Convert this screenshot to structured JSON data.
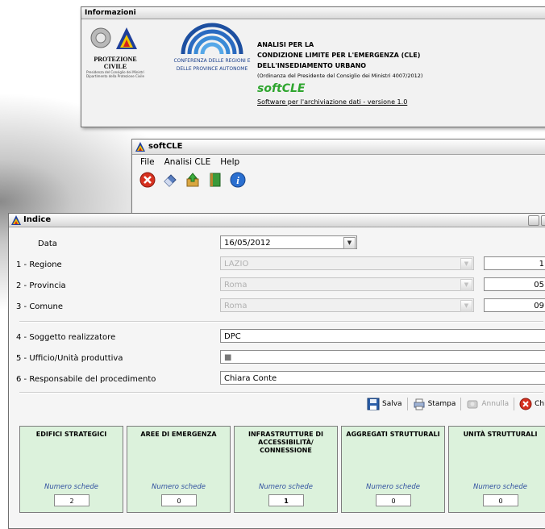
{
  "info_window": {
    "title": "Informazioni",
    "pc_name": "PROTEZIONE CIVILE",
    "pc_sub1": "Presidenza del Consiglio dei Ministri",
    "pc_sub2": "Dipartimento della Protezione Civile",
    "conf_line1": "CONFERENZA DELLE REGIONI E",
    "conf_line2": "DELLE PROVINCE AUTONOME",
    "line1": "ANALISI PER LA",
    "line2": "CONDIZIONE LIMITE PER L'EMERGENZA (CLE)",
    "line3": "DELL'INSEDIAMENTO URBANO",
    "line4": "(Ordinanza del Presidente del Consiglio dei Ministri 4007/2012)",
    "brand": "softCLE",
    "version": "Software per l'archiviazione dati - versione 1.0"
  },
  "main_window": {
    "title": "softCLE",
    "menu": [
      "File",
      "Analisi CLE",
      "Help"
    ],
    "toolbar_icons": [
      "close-icon",
      "eraser-icon",
      "upload-icon",
      "book-icon",
      "info-icon"
    ]
  },
  "indice": {
    "title": "Indice",
    "fields": {
      "data_label": "Data",
      "data_value": "16/05/2012",
      "regione_label": "1 - Regione",
      "regione_value": "LAZIO",
      "regione_code": "1",
      "provincia_label": "2 - Provincia",
      "provincia_value": "Roma",
      "provincia_code": "05",
      "comune_label": "3 - Comune",
      "comune_value": "Roma",
      "comune_code": "09",
      "soggetto_label": "4 - Soggetto realizzatore",
      "soggetto_value": "DPC",
      "ufficio_label": "5 - Ufficio/Unità produttiva",
      "ufficio_value": "■",
      "responsabile_label": "6 - Responsabile del procedimento",
      "responsabile_value": "Chiara Conte"
    },
    "actions": {
      "salva": "Salva",
      "stampa": "Stampa",
      "annulla": "Annulla",
      "chiudi": "Chiudi"
    },
    "numero_label": "Numero schede",
    "cards": [
      {
        "title": "EDIFICI STRATEGICI",
        "count": "2"
      },
      {
        "title": "AREE DI EMERGENZA",
        "count": "0"
      },
      {
        "title": "INFRASTRUTTURE DI ACCESSIBILITÀ/ CONNESSIONE",
        "count": "1"
      },
      {
        "title": "AGGREGATI STRUTTURALI",
        "count": "0"
      },
      {
        "title": "UNITÀ STRUTTURALI",
        "count": "0"
      }
    ]
  }
}
